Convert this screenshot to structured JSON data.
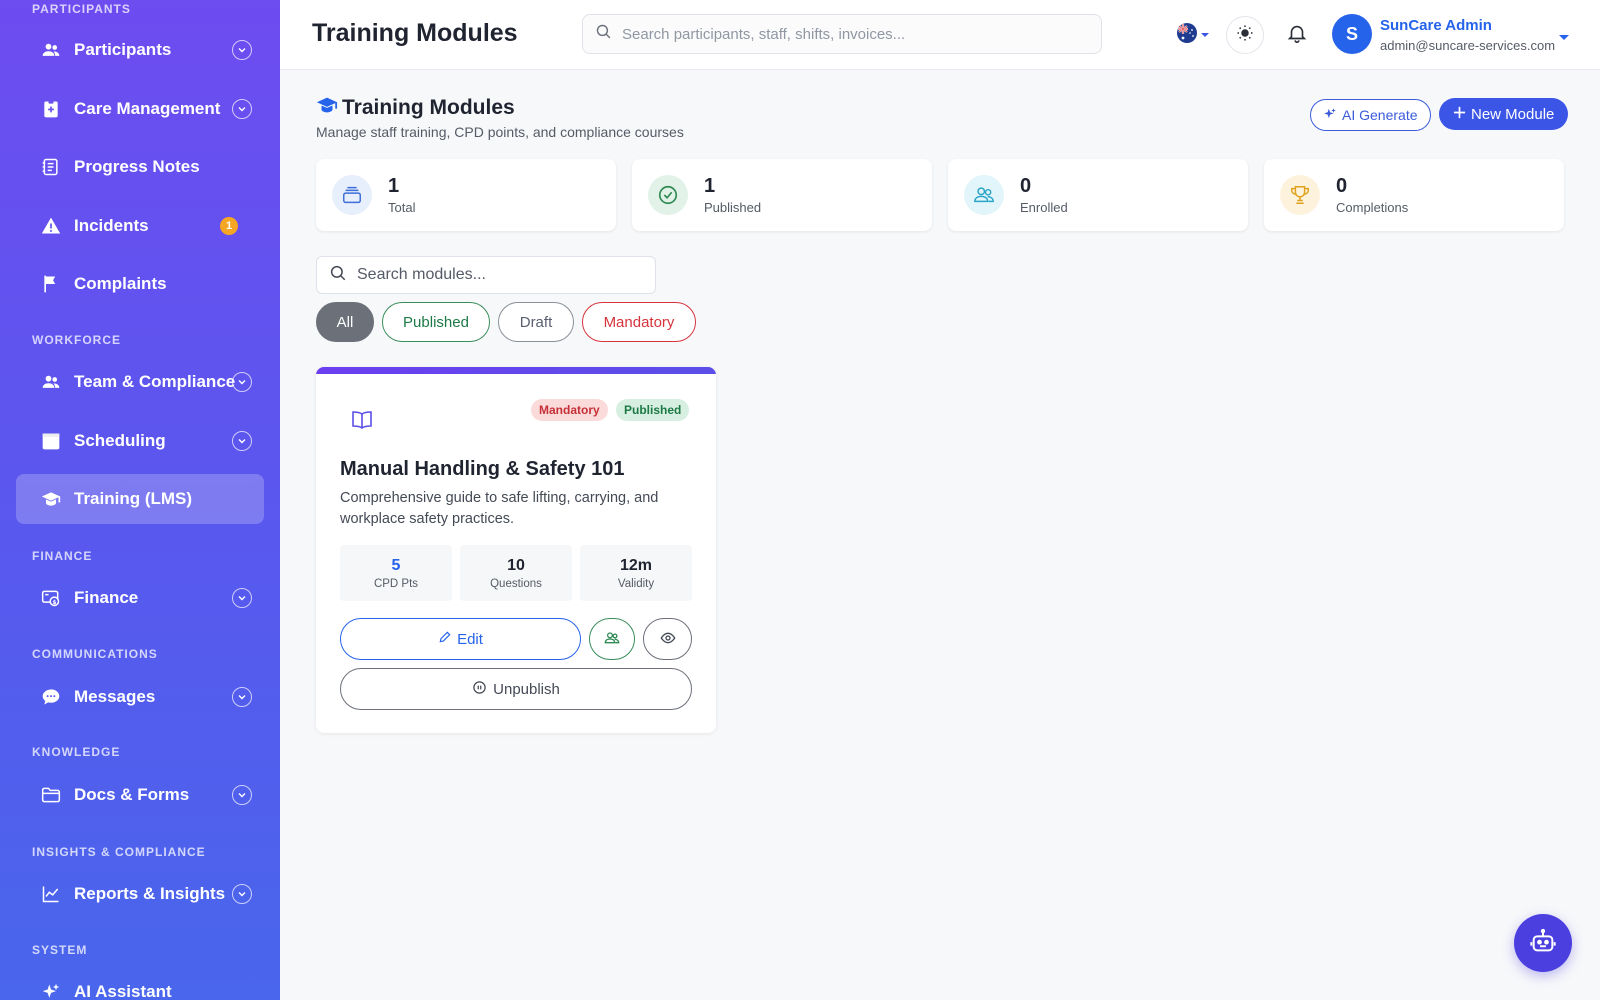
{
  "sidebar": {
    "sections": {
      "participants": "PARTICIPANTS",
      "workforce": "WORKFORCE",
      "finance": "FINANCE",
      "communications": "COMMUNICATIONS",
      "knowledge": "KNOWLEDGE",
      "insights": "INSIGHTS & COMPLIANCE",
      "system": "SYSTEM"
    },
    "items": {
      "participants": {
        "label": "Participants",
        "icon": "users-icon"
      },
      "care_management": {
        "label": "Care Management",
        "icon": "clipboard-icon"
      },
      "progress_notes": {
        "label": "Progress Notes",
        "icon": "notes-icon"
      },
      "incidents": {
        "label": "Incidents",
        "icon": "warning-icon",
        "badge": "1"
      },
      "complaints": {
        "label": "Complaints",
        "icon": "flag-icon"
      },
      "team_compliance": {
        "label": "Team & Compliance",
        "icon": "users-icon"
      },
      "scheduling": {
        "label": "Scheduling",
        "icon": "calendar-icon"
      },
      "training": {
        "label": "Training (LMS)",
        "icon": "graduation-cap-icon",
        "active": true
      },
      "finance": {
        "label": "Finance",
        "icon": "money-icon"
      },
      "messages": {
        "label": "Messages",
        "icon": "chat-icon"
      },
      "docs_forms": {
        "label": "Docs & Forms",
        "icon": "folder-icon"
      },
      "reports": {
        "label": "Reports & Insights",
        "icon": "chart-line-icon"
      },
      "ai_assistant": {
        "label": "AI Assistant",
        "icon": "sparkle-icon"
      }
    }
  },
  "header": {
    "title": "Training Modules",
    "search_placeholder": "Search participants, staff, shifts, invoices...",
    "user": {
      "initial": "S",
      "name": "SunCare Admin",
      "email": "admin@suncare-services.com"
    }
  },
  "page": {
    "heading": "Training Modules",
    "subtitle": "Manage staff training, CPD points, and compliance courses",
    "ai_button": "AI Generate",
    "new_button": "New Module"
  },
  "stats": [
    {
      "value": "1",
      "label": "Total",
      "icon": "layers-icon"
    },
    {
      "value": "1",
      "label": "Published",
      "icon": "check-circle-icon"
    },
    {
      "value": "0",
      "label": "Enrolled",
      "icon": "users-icon"
    },
    {
      "value": "0",
      "label": "Completions",
      "icon": "trophy-icon"
    }
  ],
  "module_search_placeholder": "Search modules...",
  "filters": [
    "All",
    "Published",
    "Draft",
    "Mandatory"
  ],
  "module": {
    "tags": [
      "Mandatory",
      "Published"
    ],
    "title": "Manual Handling & Safety 101",
    "description": "Comprehensive guide to safe lifting, carrying, and workplace safety practices.",
    "metrics": [
      {
        "value": "5",
        "label": "CPD Pts"
      },
      {
        "value": "10",
        "label": "Questions"
      },
      {
        "value": "12m",
        "label": "Validity"
      }
    ],
    "edit_label": "Edit",
    "unpublish_label": "Unpublish"
  },
  "colors": {
    "accent": "#3b55e6",
    "sidebar_top": "#6d4cf0",
    "sidebar_bottom": "#4966ec",
    "published_green": "#1d7a46",
    "mandatory_red": "#d6343c",
    "badge_orange": "#f5a623"
  }
}
